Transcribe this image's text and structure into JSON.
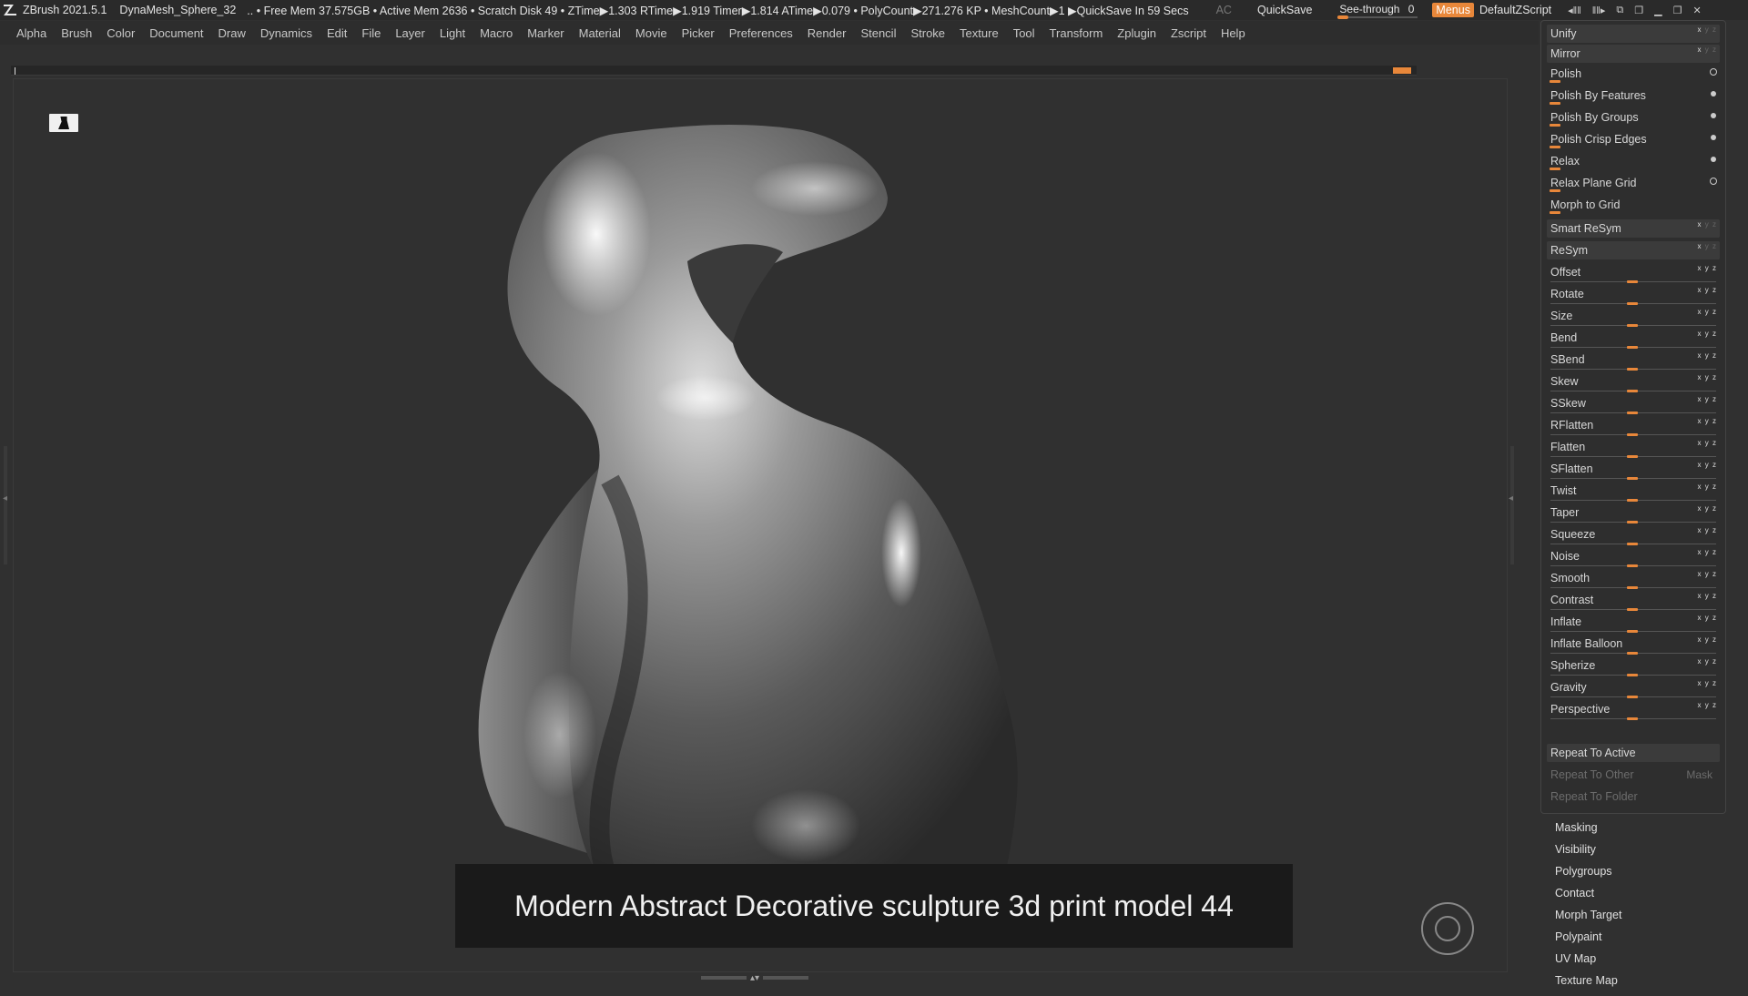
{
  "titlebar": {
    "app": "ZBrush 2021.5.1",
    "file": "DynaMesh_Sphere_32",
    "stats": ".. • Free Mem 37.575GB • Active Mem 2636 • Scratch Disk 49 • ZTime▶1.303 RTime▶1.919 Timer▶1.814 ATime▶0.079 • PolyCount▶271.276 KP • MeshCount▶1 ▶QuickSave In 59 Secs",
    "ac": "AC",
    "quicksave": "QuickSave",
    "see_through_label": "See-through",
    "see_through_value": "0",
    "menus": "Menus",
    "default_zscript": "DefaultZScript"
  },
  "menubar": [
    "Alpha",
    "Brush",
    "Color",
    "Document",
    "Draw",
    "Dynamics",
    "Edit",
    "File",
    "Layer",
    "Light",
    "Macro",
    "Marker",
    "Material",
    "Movie",
    "Picker",
    "Preferences",
    "Render",
    "Stencil",
    "Stroke",
    "Texture",
    "Tool",
    "Transform",
    "Zplugin",
    "Zscript",
    "Help"
  ],
  "caption": "Modern Abstract Decorative sculpture 3d print model 44",
  "panel": {
    "unify": "Unify",
    "mirror": "Mirror",
    "polish": "Polish",
    "polish_features": "Polish By Features",
    "polish_groups": "Polish By Groups",
    "polish_crisp": "Polish Crisp Edges",
    "relax": "Relax",
    "relax_plane": "Relax Plane Grid",
    "morph_grid": "Morph to Grid",
    "smart_resym": "Smart ReSym",
    "resym": "ReSym",
    "deformers": [
      "Offset",
      "Rotate",
      "Size",
      "Bend",
      "SBend",
      "Skew",
      "SSkew",
      "RFlatten",
      "Flatten",
      "SFlatten",
      "Twist",
      "Taper",
      "Squeeze",
      "Noise",
      "Smooth",
      "Contrast",
      "Inflate",
      "Inflate Balloon",
      "Spherize",
      "Gravity",
      "Perspective"
    ],
    "repeat_active": "Repeat To Active",
    "repeat_other": "Repeat To Other",
    "mask": "Mask",
    "repeat_folder": "Repeat To Folder"
  },
  "subpalettes": [
    "Masking",
    "Visibility",
    "Polygroups",
    "Contact",
    "Morph Target",
    "Polypaint",
    "UV Map",
    "Texture Map"
  ],
  "colors": {
    "accent": "#e8873a",
    "background": "#303030",
    "panel": "#2e2e2e"
  },
  "icons": [
    "zbrush-logo-icon",
    "camera-floor-icon",
    "navigation-gizmo-icon",
    "minimize-icon",
    "restore-icon",
    "close-icon"
  ]
}
